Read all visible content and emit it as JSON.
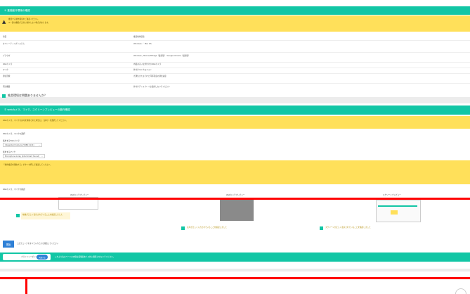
{
  "section1": {
    "title": "① 推奨動作環境の確認",
    "notice": "推奨する動作環境をご確認ください。",
    "notice_line2": "※一部の機能が正常に動作しない場合があります。",
    "col_left": "項目",
    "col_right": "推奨動作環境",
    "rows": [
      {
        "label": "オペレーティングシステム",
        "value": "Windows ／ Mac OS"
      },
      {
        "label": "ブラウザ",
        "value": "Windows：Microsoft Edge（最新版）・Google Chrome（最新版）"
      },
      {
        "label": "Webカメラ",
        "value": "内蔵あるいは外付けのWebカメラ"
      },
      {
        "label": "マイク",
        "value": "外付けマイクロフォン"
      },
      {
        "label": "通信回線",
        "value": "光通信またはそれと同等程度の通信速度"
      },
      {
        "label": "周辺機器",
        "value": "外付けディスプレイは使用しないでください"
      }
    ],
    "question_label": "推奨環境は問題ありませんか？"
  },
  "section2": {
    "title": "② webカメラ、マイク、スクリーンプレビューの動作確認",
    "notice": "Webカメラ、マイクの許可を求められた場合は、［許可］を選択してください。",
    "camera_label": "Webカメラ、マイクの選択",
    "camera_select_label": "使用するWebカメラ",
    "camera_select_value": "Integrated Camera (5986:1141)",
    "mic_select_label": "使用するマイク",
    "mic_select_value": "Microphone Array (Intel Smart Sound)",
    "info_text": "「動作確認を開始する」ボタンを押して確認してください。",
    "preview_label": "Webカメラ、マイクの確認",
    "col_camera": "Webカメラプレビュー",
    "col_web": "Webカメラプレビュー",
    "col_screen": "スクリーンプレビュー",
    "check1": "映像が正しく表示されていることを確認しました",
    "check2": "音声が正しく入力されていることを確認しました",
    "check3": "スクリーンが正しく表示されていることを確認しました",
    "start_button": "開始",
    "start_note": "上記チェックをすべて入れてから開始してください",
    "agree_button": "同意する",
    "agree_prefix": "プライバシーポリシー",
    "bottom_note": "これより先のページの内容は受験者本人以外に閲覧させないでください。"
  },
  "colors": {
    "accent": "#12c6a5",
    "warning": "#ffe05a",
    "highlight": "#ff0000",
    "button": "#2f80d6"
  }
}
